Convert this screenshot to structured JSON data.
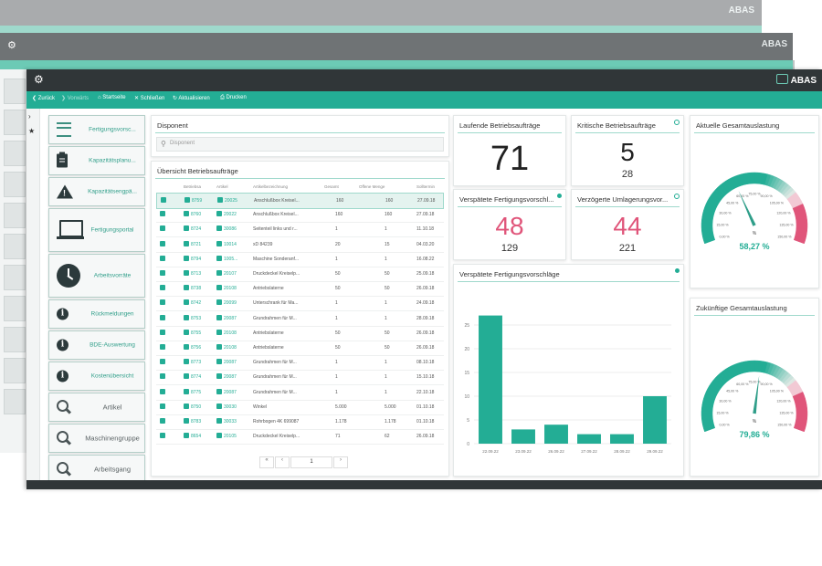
{
  "brand": "ABAS",
  "toolbar": {
    "back": "Zurück",
    "forward": "Vorwärts",
    "home": "Startseite",
    "close": "Schließen",
    "refresh": "Aktualisieren",
    "print": "Drucken"
  },
  "nav": [
    {
      "label": "Fertigungsvorsc...",
      "icon": "list-icon"
    },
    {
      "label": "Kapazitätsplanu...",
      "icon": "clipboard-icon"
    },
    {
      "label": "Kapazitätsengpä...",
      "icon": "warning-icon"
    },
    {
      "label": "Fertigungsportal",
      "icon": "laptop-icon"
    },
    {
      "label": "Arbeitsvorräte",
      "icon": "clock-icon"
    },
    {
      "label": "Rückmeldungen",
      "icon": "info-icon"
    },
    {
      "label": "BDE-Auswertung",
      "icon": "info-icon"
    },
    {
      "label": "Kostenübersicht",
      "icon": "info-icon"
    },
    {
      "label": "Artikel",
      "icon": "search-icon"
    },
    {
      "label": "Maschinengruppe",
      "icon": "search-icon"
    },
    {
      "label": "Arbeitsgang",
      "icon": "search-icon"
    }
  ],
  "disponent": {
    "title": "Disponent",
    "placeholder": "Disponent"
  },
  "orders": {
    "title": "Übersicht Betriebsaufträge",
    "columns": [
      "Betriebsa",
      "Artikel",
      "Artikelbezeichnung",
      "Gesamt",
      "Offene Menge",
      "Solltermin"
    ],
    "rows": [
      {
        "auftrag": "8759",
        "artikel": "20025",
        "bez": "Anschlußbox Kreisel...",
        "gesamt": "160",
        "offen": "160",
        "termin": "27.09.18"
      },
      {
        "auftrag": "8760",
        "artikel": "20022",
        "bez": "Anschlußbox Kreisel...",
        "gesamt": "160",
        "offen": "160",
        "termin": "27.09.18"
      },
      {
        "auftrag": "8724",
        "artikel": "30086",
        "bez": "Seitenteil links und r...",
        "gesamt": "1",
        "offen": "1",
        "termin": "11.10.18"
      },
      {
        "auftrag": "8721",
        "artikel": "10014",
        "bez": "xD 84239",
        "gesamt": "20",
        "offen": "15",
        "termin": "04.03.20"
      },
      {
        "auftrag": "8794",
        "artikel": "1005...",
        "bez": "Maschine Sonderanf...",
        "gesamt": "1",
        "offen": "1",
        "termin": "16.08.22"
      },
      {
        "auftrag": "8713",
        "artikel": "20107",
        "bez": "Druckdeckel Kreiselp...",
        "gesamt": "50",
        "offen": "50",
        "termin": "25.09.18"
      },
      {
        "auftrag": "8738",
        "artikel": "20108",
        "bez": "Antriebslaterne",
        "gesamt": "50",
        "offen": "50",
        "termin": "26.09.18"
      },
      {
        "auftrag": "8742",
        "artikel": "20099",
        "bez": "Unterschrank für Ma...",
        "gesamt": "1",
        "offen": "1",
        "termin": "24.09.18"
      },
      {
        "auftrag": "8753",
        "artikel": "20087",
        "bez": "Grundrahmen für M...",
        "gesamt": "1",
        "offen": "1",
        "termin": "28.09.18"
      },
      {
        "auftrag": "8755",
        "artikel": "20108",
        "bez": "Antriebslaterne",
        "gesamt": "50",
        "offen": "50",
        "termin": "26.09.18"
      },
      {
        "auftrag": "8756",
        "artikel": "20108",
        "bez": "Antriebslaterne",
        "gesamt": "50",
        "offen": "50",
        "termin": "26.09.18"
      },
      {
        "auftrag": "8773",
        "artikel": "20087",
        "bez": "Grundrahmen für M...",
        "gesamt": "1",
        "offen": "1",
        "termin": "08.10.18"
      },
      {
        "auftrag": "8774",
        "artikel": "20087",
        "bez": "Grundrahmen für M...",
        "gesamt": "1",
        "offen": "1",
        "termin": "15.10.18"
      },
      {
        "auftrag": "8775",
        "artikel": "20087",
        "bez": "Grundrahmen für M...",
        "gesamt": "1",
        "offen": "1",
        "termin": "22.10.18"
      },
      {
        "auftrag": "8750",
        "artikel": "30030",
        "bez": "Winkel",
        "gesamt": "5.000",
        "offen": "5.000",
        "termin": "01.10.18"
      },
      {
        "auftrag": "8783",
        "artikel": "30033",
        "bez": "Rohrbogen 4K 699087",
        "gesamt": "1.178",
        "offen": "1.178",
        "termin": "01.10.18"
      },
      {
        "auftrag": "8654",
        "artikel": "20105",
        "bez": "Druckdeckel Kreiselp...",
        "gesamt": "71",
        "offen": "62",
        "termin": "26.09.18"
      }
    ]
  },
  "pager": {
    "page": "1"
  },
  "kpis": {
    "laufende": {
      "title": "Laufende Betriebsaufträge",
      "value": "71"
    },
    "kritische": {
      "title": "Kritische Betriebsaufträge",
      "value": "5",
      "sub": "28"
    },
    "verspaetet": {
      "title": "Verspätete Fertigungsvorschl...",
      "value": "48",
      "sub": "129"
    },
    "verzoegert": {
      "title": "Verzögerte Umlagerungsvor...",
      "value": "44",
      "sub": "221"
    }
  },
  "colors": {
    "accent": "#23ad95",
    "danger": "#e0557a",
    "dark": "#303638"
  },
  "gauge1": {
    "title": "Aktuelle Gesamtauslastung",
    "value": "58,27 %",
    "pct": 58.27
  },
  "gauge2": {
    "title": "Zukünftige Gesamtauslastung",
    "value": "79,86 %",
    "pct": 79.86
  },
  "gauge_ticks": [
    "0,00 %",
    "15,00 %",
    "30,00 %",
    "45,00 %",
    "60,00 %",
    "75,00 %",
    "90,00 %",
    "105,00 %",
    "120,00 %",
    "135,00 %",
    "150,00 %"
  ],
  "gauge_unit": "%",
  "chart_data": {
    "type": "bar",
    "title": "Verspätete Fertigungsvorschläge",
    "categories": [
      "22.09.22",
      "23.09.22",
      "26.09.22",
      "27.09.22",
      "28.09.22",
      "29.09.22"
    ],
    "values": [
      27,
      3,
      4,
      2,
      2,
      10
    ],
    "yticks": [
      "0",
      "5",
      "10",
      "15",
      "20",
      "25"
    ],
    "ylim": [
      0,
      30
    ],
    "grid": true
  }
}
